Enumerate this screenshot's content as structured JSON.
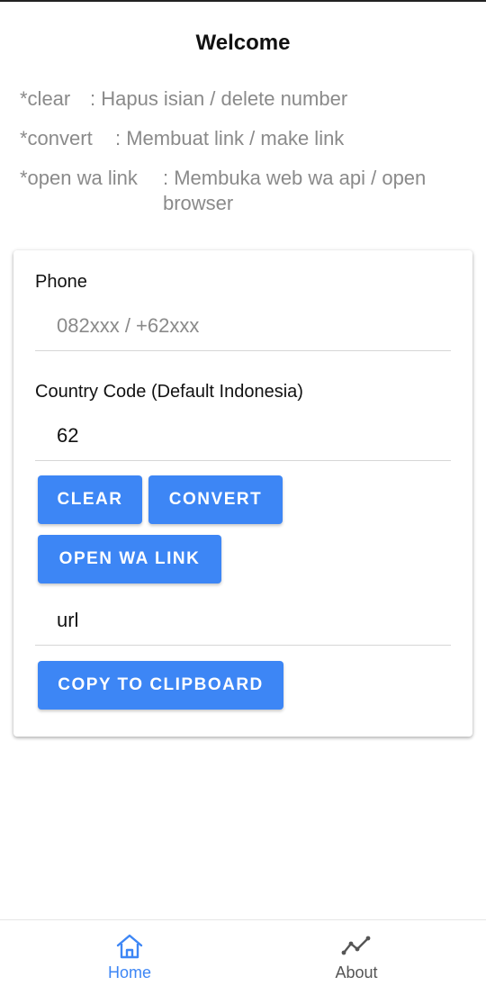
{
  "header": {
    "title": "Welcome"
  },
  "help": [
    {
      "key": "*clear",
      "desc": ": Hapus isian / delete number"
    },
    {
      "key": "*convert",
      "desc": ": Membuat link / make link"
    },
    {
      "key": "*open wa link",
      "desc": ": Membuka web wa api / open browser"
    }
  ],
  "form": {
    "phone_label": "Phone",
    "phone_placeholder": "082xxx / +62xxx",
    "country_label": "Country Code (Default Indonesia)",
    "country_value": "62",
    "clear_label": "CLEAR",
    "convert_label": "CONVERT",
    "open_wa_label": "OPEN WA LINK",
    "url_value": "url",
    "copy_label": "COPY TO CLIPBOARD"
  },
  "nav": {
    "items": [
      {
        "label": "Home",
        "icon": "home-icon",
        "active": true
      },
      {
        "label": "About",
        "icon": "trend-icon",
        "active": false
      }
    ]
  },
  "colors": {
    "accent": "#3d86f5",
    "muted": "#8a8a8a"
  }
}
